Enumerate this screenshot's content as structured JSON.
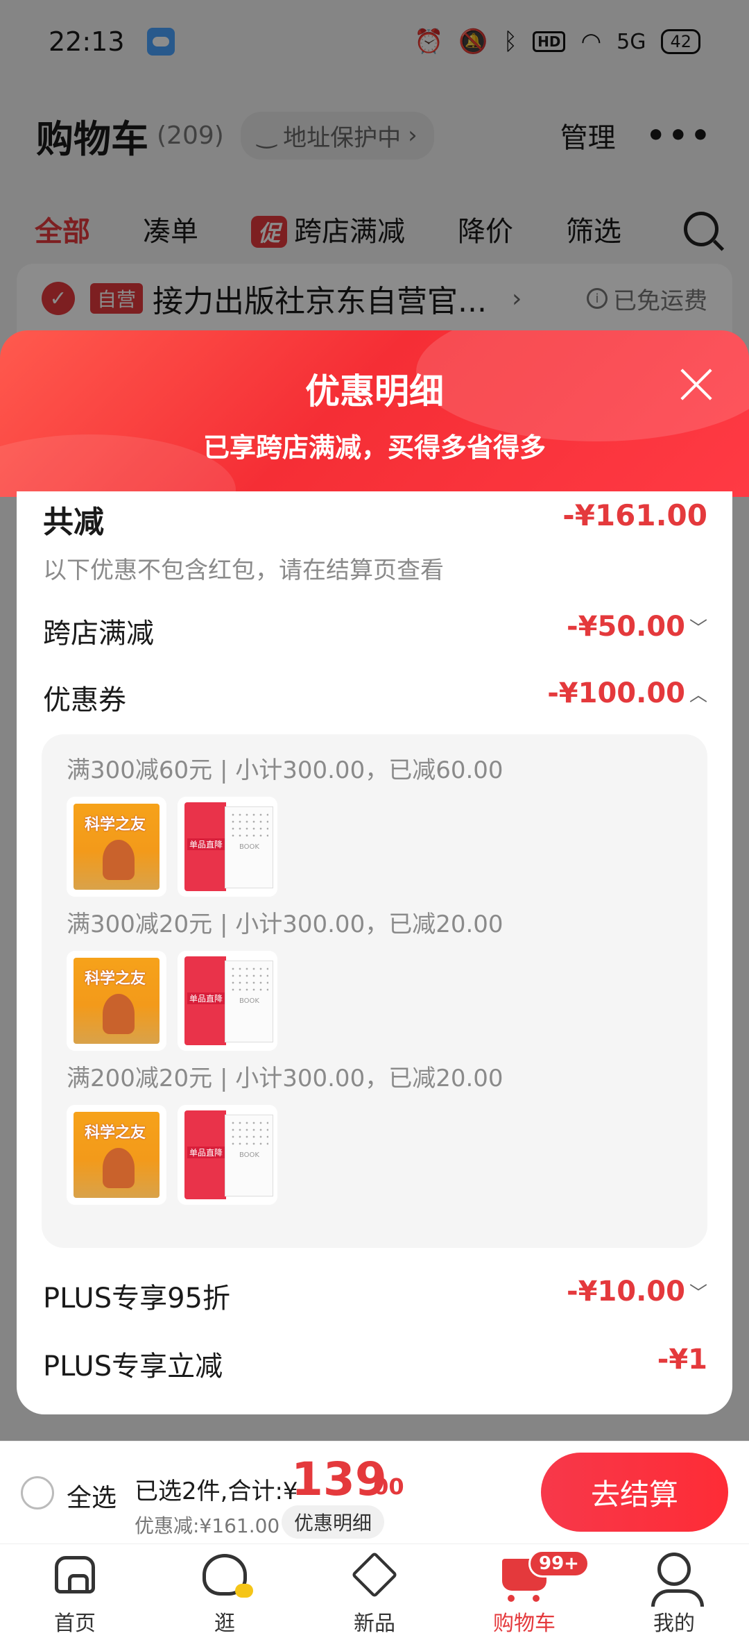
{
  "status_bar": {
    "time": "22:13",
    "network": "5G",
    "battery": "42"
  },
  "header": {
    "title": "购物车",
    "count": "(209)",
    "address_protect": "地址保护中",
    "manage": "管理"
  },
  "tabs": [
    {
      "label": "全部"
    },
    {
      "label": "凑单"
    },
    {
      "label": "跨店满减",
      "tag": "促"
    },
    {
      "label": "降价"
    },
    {
      "label": "筛选"
    }
  ],
  "store": {
    "tag": "自营",
    "name": "接力出版社京东自营官...",
    "shipping": "已免运费"
  },
  "sheet": {
    "title": "优惠明细",
    "subtitle": "已享跨店满减，买得多省得多",
    "total": {
      "label": "共减",
      "amount": "-¥161.00"
    },
    "note": "以下优惠不包含红包，请在结算页查看",
    "rows": [
      {
        "label": "跨店满减",
        "amount": "-¥50.00"
      },
      {
        "label": "优惠券",
        "amount": "-¥100.00"
      },
      {
        "label": "PLUS专享95折",
        "amount": "-¥10.00"
      },
      {
        "label": "PLUS专享立减",
        "amount": "-¥1"
      }
    ],
    "coupons": [
      {
        "text": "满300减60元 | 小计300.00，已减60.00"
      },
      {
        "text": "满300减20元 | 小计300.00，已减20.00"
      },
      {
        "text": "满200减20元 | 小计300.00，已减20.00"
      }
    ]
  },
  "checkout": {
    "select_all": "全选",
    "selected_text": "已选2件,合计:¥",
    "price_int": "139",
    "price_dec": ".00",
    "discount": "优惠减:¥161.00",
    "detail_button": "优惠明细",
    "checkout_button": "去结算"
  },
  "tabbar": [
    {
      "label": "首页",
      "icon": "home-icon"
    },
    {
      "label": "逛",
      "icon": "browse-icon"
    },
    {
      "label": "新品",
      "icon": "new-icon"
    },
    {
      "label": "购物车",
      "icon": "cart-icon",
      "badge": "99+"
    },
    {
      "label": "我的",
      "icon": "profile-icon"
    }
  ],
  "colors": {
    "accent": "#e4393c",
    "sheet_header": "#f52e35"
  }
}
